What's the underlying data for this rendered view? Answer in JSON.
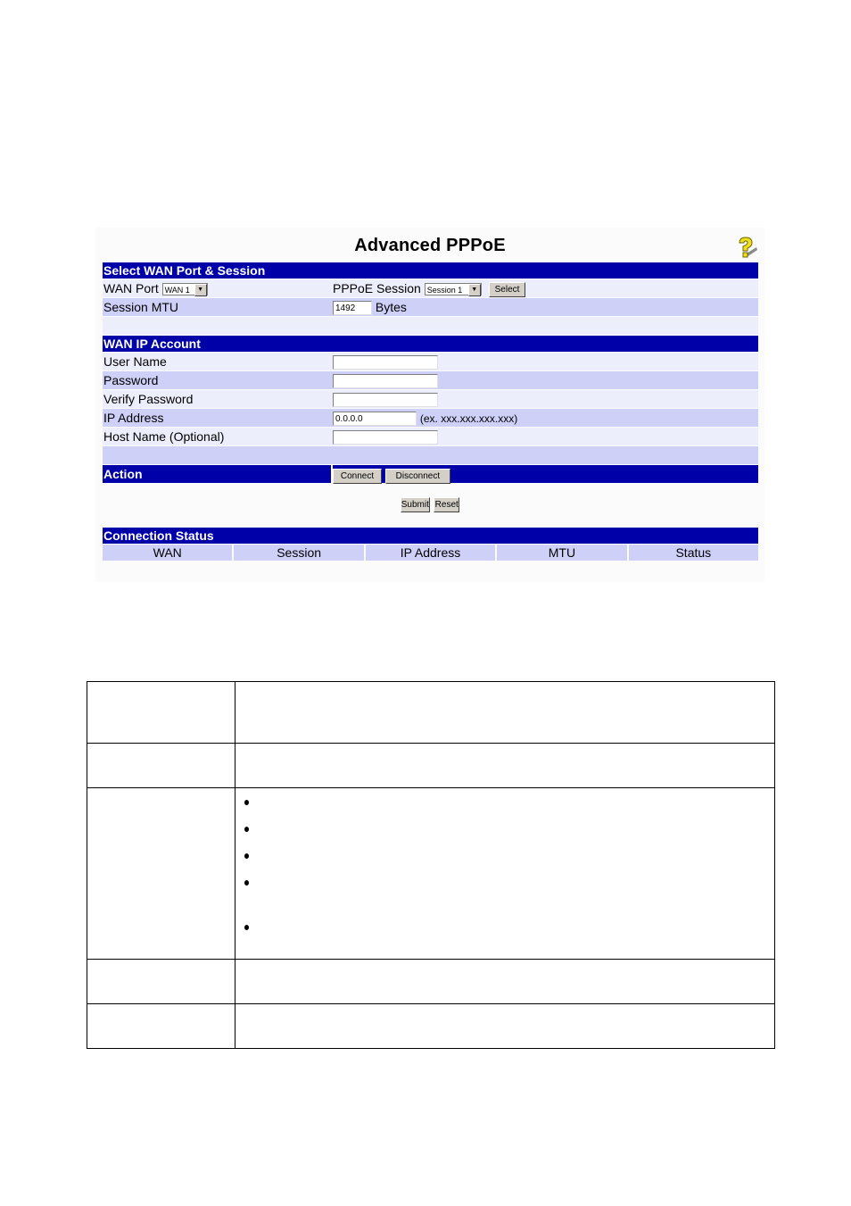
{
  "screen": {
    "title": "Advanced PPPoE",
    "help_icon": "help-question-icon",
    "sections": {
      "select": {
        "header": "Select WAN Port & Session",
        "wan_port_label": "WAN Port",
        "wan_port_value": "WAN 1",
        "pppoe_session_label": "PPPoE Session",
        "pppoe_session_value": "Session 1",
        "select_button": "Select",
        "mtu_label": "Session MTU",
        "mtu_value": "1492",
        "mtu_unit": "Bytes"
      },
      "account": {
        "header": "WAN IP Account",
        "fields": [
          {
            "label": "User Name",
            "value": ""
          },
          {
            "label": "Password",
            "value": ""
          },
          {
            "label": "Verify Password",
            "value": ""
          },
          {
            "label": "IP Address",
            "value": "0.0.0.0",
            "hint": "(ex. xxx.xxx.xxx.xxx)"
          },
          {
            "label": "Host Name (Optional)",
            "value": ""
          }
        ]
      },
      "action": {
        "header": "Action",
        "connect_button": "Connect",
        "disconnect_button": "Disconnect"
      },
      "form_buttons": {
        "submit": "Submit",
        "reset": "Reset"
      },
      "status": {
        "header": "Connection Status",
        "columns": [
          "WAN",
          "Session",
          "IP Address",
          "MTU",
          "Status"
        ]
      }
    },
    "colors": {
      "header_bar": "#0000a8",
      "row_light": "#eceefb",
      "row_dark": "#cfd0f8",
      "button_face": "#d4d0c8"
    }
  },
  "doc_table": {
    "rows": 5,
    "bullet_count": 5
  }
}
